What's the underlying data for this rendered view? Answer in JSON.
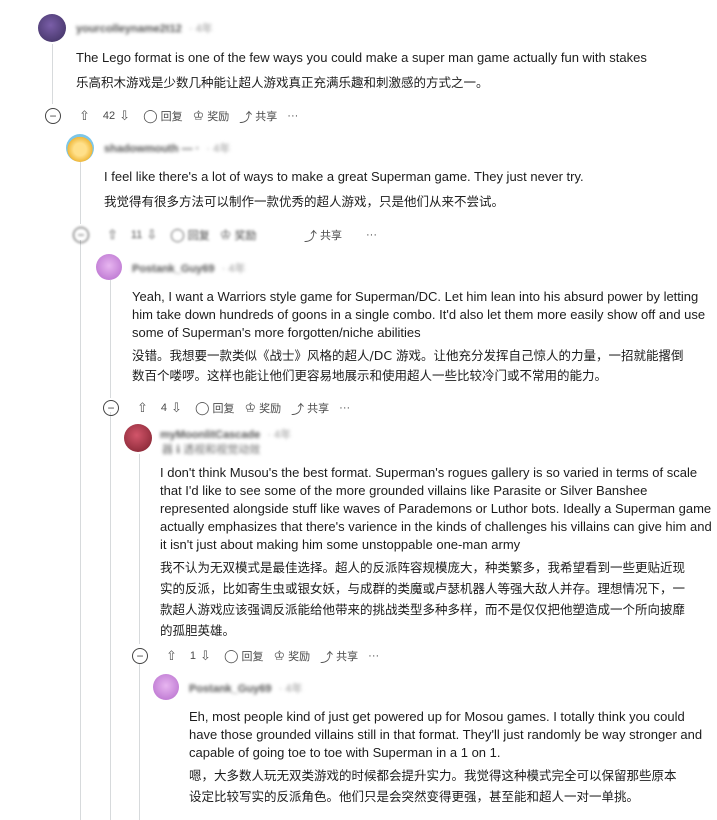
{
  "actions": {
    "reply": "回复",
    "award": "奖励",
    "share": "共享",
    "more": "···"
  },
  "comments": [
    {
      "user": "yourcolleyname2t12",
      "time": "· 4年",
      "en": "The Lego format is one of the few ways you could make a super man game actually fun with stakes",
      "zh": "乐高积木游戏是少数几种能让超人游戏真正充满乐趣和刺激感的方式之一。",
      "votes": "42",
      "avatar_color": "#5a4a8a"
    },
    {
      "user": "shadowmouth — ·",
      "time": "· 4年",
      "en": "I feel like there's a lot of ways to make a great Superman game. They just never try.",
      "zh": "我觉得有很多方法可以制作一款优秀的超人游戏，只是他们从来不尝试。",
      "votes": "11",
      "avatar_color": "#f3c04a"
    },
    {
      "user": "Postank_Guy69",
      "time": "· 4年",
      "en1": "Yeah, I want a Warriors style game for Superman/DC. Let him lean into his absurd power by letting",
      "en2": "him take down hundreds of goons in a single combo. It'd also let them more easily show off and use",
      "en3": "some of Superman's more forgotten/niche abilities",
      "zh1": "没错。我想要一款类似《战士》风格的超人/DC 游戏。让他充分发挥自己惊人的力量，一招就能撂倒",
      "zh2": "数百个喽啰。这样也能让他们更容易地展示和使用超人一些比较冷门或不常用的能力。",
      "votes": "4",
      "avatar_color": "#c98ad8"
    },
    {
      "user": "myMoonlitCascade",
      "time": "· 4年",
      "flair": "器 ℹ 透视和视觉动效",
      "en1": "I don't think Musou's the best format. Superman's rogues gallery is so varied in terms of scale",
      "en2": "that I'd like to see some of the more grounded villains like Parasite or Silver Banshee",
      "en3": "represented alongside stuff like waves of Parademons or Luthor bots. Ideally a Superman game",
      "en4": "actually emphasizes that there's varience in the kinds of challenges his villains can give him and",
      "en5": "it isn't just about making him some unstoppable one-man army",
      "zh1": "我不认为无双模式是最佳选择。超人的反派阵容规模庞大，种类繁多，我希望看到一些更贴近现",
      "zh2": "实的反派，比如寄生虫或银女妖，与成群的类魔或卢瑟机器人等强大敌人并存。理想情况下，一",
      "zh3": "款超人游戏应该强调反派能给他带来的挑战类型多种多样，而不是仅仅把他塑造成一个所向披靡",
      "zh4": "的孤胆英雄。",
      "votes": "1",
      "avatar_color": "#a8323a"
    },
    {
      "user": "Postank_Guy69",
      "time": "· 4年",
      "en1": "Eh, most people kind of just get powered up for Mosou games. I totally think you could",
      "en2": "have those grounded villains still in that format. They'll just randomly be way stronger and",
      "en3": "capable of going toe to toe with Superman in a 1 on 1.",
      "zh1": "嗯，大多数人玩无双类游戏的时候都会提升实力。我觉得这种模式完全可以保留那些原本",
      "zh2": "设定比较写实的反派角色。他们只是会突然变得更强，甚至能和超人一对一单挑。",
      "avatar_color": "#c98ad8"
    }
  ]
}
